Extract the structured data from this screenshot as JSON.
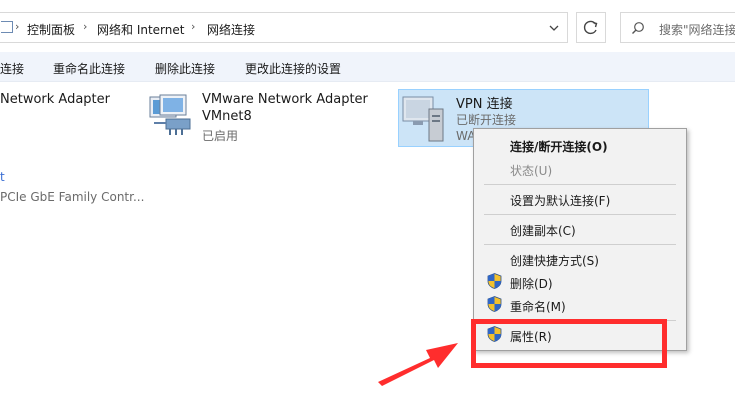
{
  "address": {
    "crumbs": [
      "控制面板",
      "网络和 Internet",
      "网络连接"
    ],
    "search_placeholder": "搜索\"网络连接"
  },
  "commands": [
    "连接",
    "重命名此连接",
    "删除此连接",
    "更改此连接的设置"
  ],
  "adapters": [
    {
      "name": "Network Adapter",
      "line2": "",
      "line3": ""
    },
    {
      "name": "VMware Network Adapter",
      "line2": "VMnet8",
      "line3": "已启用"
    },
    {
      "name": "VPN 连接",
      "line2": "已断开连接",
      "line3": "WA"
    }
  ],
  "left_partial": {
    "line1": "t",
    "line2": "PCIe GbE Family Contr..."
  },
  "context_menu": {
    "items": [
      {
        "label": "连接/断开连接(O)",
        "bold": true,
        "disabled": false,
        "shield": false
      },
      {
        "label": "状态(U)",
        "bold": false,
        "disabled": true,
        "shield": false
      },
      {
        "label": "设置为默认连接(F)",
        "bold": false,
        "disabled": false,
        "shield": false
      },
      {
        "label": "创建副本(C)",
        "bold": false,
        "disabled": false,
        "shield": false
      },
      {
        "label": "创建快捷方式(S)",
        "bold": false,
        "disabled": false,
        "shield": false
      },
      {
        "label": "删除(D)",
        "bold": false,
        "disabled": false,
        "shield": true
      },
      {
        "label": "重命名(M)",
        "bold": false,
        "disabled": false,
        "shield": true
      },
      {
        "label": "属性(R)",
        "bold": false,
        "disabled": false,
        "shield": true
      }
    ]
  },
  "colors": {
    "annotation": "#ff2d2d",
    "selection": "#cce4f7",
    "command_bar": "#f0f4fb"
  }
}
